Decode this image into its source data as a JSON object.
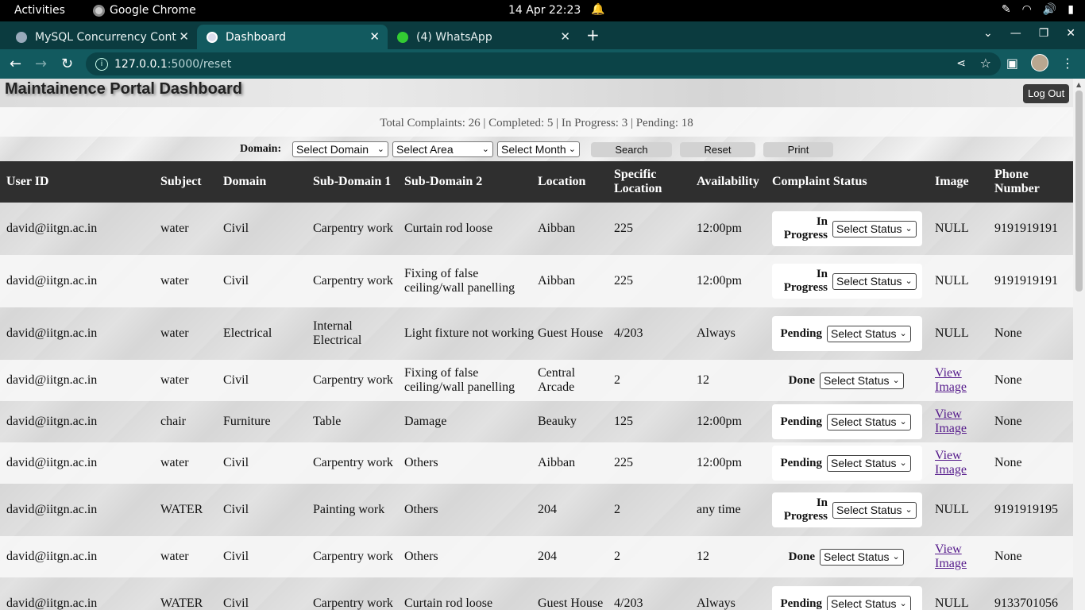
{
  "os_bar": {
    "activities": "Activities",
    "app_name": "Google Chrome",
    "clock": "14 Apr  22:23"
  },
  "browser": {
    "tabs": [
      {
        "title": "MySQL Concurrency Cont",
        "active": false
      },
      {
        "title": "Dashboard",
        "active": true
      },
      {
        "title": "(4) WhatsApp",
        "active": false
      }
    ],
    "url_host": "127.0.0.1",
    "url_path": ":5000/reset"
  },
  "page": {
    "title": "Maintainence Portal Dashboard",
    "logout_label": "Log Out",
    "stats": "Total Complaints: 26 | Completed: 5 | In Progress: 3 | Pending: 18",
    "filters": {
      "domain_label": "Domain:",
      "domain_select": "Select Domain",
      "area_select": "Select Area",
      "month_select": "Select Month",
      "search_label": "Search",
      "reset_label": "Reset",
      "print_label": "Print"
    }
  },
  "table": {
    "headers": [
      "User ID",
      "Subject",
      "Domain",
      "Sub-Domain 1",
      "Sub-Domain 2",
      "Location",
      "Specific Location",
      "Availability",
      "Complaint Status",
      "Image",
      "Phone Number"
    ],
    "status_select_label": "Select Status",
    "rows": [
      {
        "user": "david@iitgn.ac.in",
        "subject": "water",
        "domain": "Civil",
        "sub1": "Carpentry work",
        "sub2": "Curtain rod loose",
        "location": "Aibban",
        "specific": "225",
        "availability": "12:00pm",
        "status": "In Progress",
        "image": "NULL",
        "phone": "9191919191"
      },
      {
        "user": "david@iitgn.ac.in",
        "subject": "water",
        "domain": "Civil",
        "sub1": "Carpentry work",
        "sub2": "Fixing of false ceiling/wall panelling",
        "location": "Aibban",
        "specific": "225",
        "availability": "12:00pm",
        "status": "In Progress",
        "image": "NULL",
        "phone": "9191919191"
      },
      {
        "user": "david@iitgn.ac.in",
        "subject": "water",
        "domain": "Electrical",
        "sub1": "Internal Electrical",
        "sub2": "Light fixture not working",
        "location": "Guest House",
        "specific": "4/203",
        "availability": "Always",
        "status": "Pending",
        "image": "NULL",
        "phone": "None"
      },
      {
        "user": "david@iitgn.ac.in",
        "subject": "water",
        "domain": "Civil",
        "sub1": "Carpentry work",
        "sub2": "Fixing of false ceiling/wall panelling",
        "location": "Central Arcade",
        "specific": "2",
        "availability": "12",
        "status": "Done",
        "image": "View Image",
        "phone": "None"
      },
      {
        "user": "david@iitgn.ac.in",
        "subject": "chair",
        "domain": "Furniture",
        "sub1": "Table",
        "sub2": "Damage",
        "location": "Beauky",
        "specific": "125",
        "availability": "12:00pm",
        "status": "Pending",
        "image": "View Image",
        "phone": "None"
      },
      {
        "user": "david@iitgn.ac.in",
        "subject": "water",
        "domain": "Civil",
        "sub1": "Carpentry work",
        "sub2": "Others",
        "location": "Aibban",
        "specific": "225",
        "availability": "12:00pm",
        "status": "Pending",
        "image": "View Image",
        "phone": "None"
      },
      {
        "user": "david@iitgn.ac.in",
        "subject": "WATER",
        "domain": "Civil",
        "sub1": "Painting work",
        "sub2": "Others",
        "location": "204",
        "specific": "2",
        "availability": "any time",
        "status": "In Progress",
        "image": "NULL",
        "phone": "9191919195"
      },
      {
        "user": "david@iitgn.ac.in",
        "subject": "water",
        "domain": "Civil",
        "sub1": "Carpentry work",
        "sub2": "Others",
        "location": "204",
        "specific": "2",
        "availability": "12",
        "status": "Done",
        "image": "View Image",
        "phone": "None"
      },
      {
        "user": "david@iitgn.ac.in",
        "subject": "WATER",
        "domain": "Civil",
        "sub1": "Carpentry work",
        "sub2": "Curtain rod loose",
        "location": "Guest House",
        "specific": "4/203",
        "availability": "Always",
        "status": "Pending",
        "image": "NULL",
        "phone": "9133701056"
      }
    ]
  }
}
